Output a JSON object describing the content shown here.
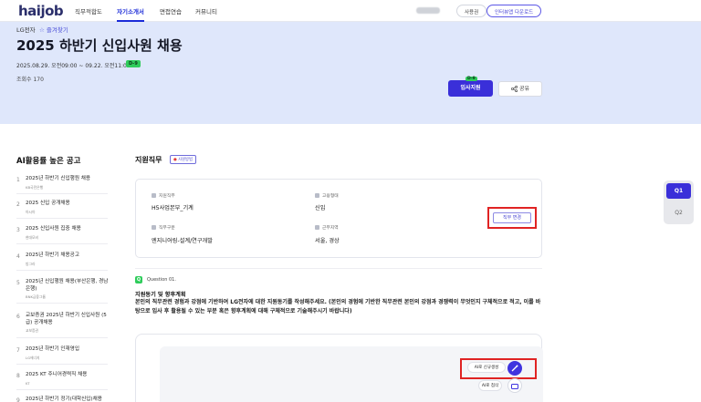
{
  "header": {
    "logo": "haijob",
    "tabs": [
      {
        "label": "직무적합도",
        "active": false
      },
      {
        "label": "자기소개서",
        "active": true
      },
      {
        "label": "면접연습",
        "active": false
      },
      {
        "label": "커뮤니티",
        "active": false
      }
    ],
    "user_label": "사용권",
    "download_button": "인터뷰앱 다운로드"
  },
  "job": {
    "company": "LG전자",
    "favorite": "즐겨찾기",
    "title": "2025 하반기 신입사원 채용",
    "period": "2025.08.29. 오전09:00 ~ 09.22. 오전11:00",
    "dday": "D-9",
    "views": "조회수 170",
    "apply_button": "입사지원",
    "apply_dday": "D-9",
    "share_button": "공유"
  },
  "sidebar": {
    "title": "AI활용률 높은 공고",
    "items": [
      {
        "num": "1",
        "title": "2025년 하반기 신입행원 채용",
        "company": "KB국민은행"
      },
      {
        "num": "2",
        "title": "2025 신입 공개채용",
        "company": "아시아"
      },
      {
        "num": "3",
        "title": "2025 신입사원 집중 채용",
        "company": "현대모비"
      },
      {
        "num": "4",
        "title": "2025년 하반기 채용공고",
        "company": "방그라"
      },
      {
        "num": "5",
        "title": "2025년 신입행원 채용(부산은행, 경남은행)",
        "company": "BNK금융그룹"
      },
      {
        "num": "6",
        "title": "교보증권 2025년 하반기 신입사원 (5급) 공개채용",
        "company": "교보증권"
      },
      {
        "num": "7",
        "title": "2025년 하반기 인재영입",
        "company": "LG에너지"
      },
      {
        "num": "8",
        "title": "2025 KT 주니어경력직 채용",
        "company": "KT"
      },
      {
        "num": "9",
        "title": "2025년 하반기 정기(대학신입)채용",
        "company": ""
      }
    ]
  },
  "position": {
    "section_title": "지원직무",
    "badge": "사원방법",
    "labels": {
      "job": "지원직무",
      "type": "고용형태",
      "category": "직무구분",
      "location": "근무지역"
    },
    "values": {
      "job": "H5사업본부_기계",
      "type": "신입",
      "category": "엔지니어링-설계/연구개발",
      "location": "서울, 경상"
    },
    "change_button": "직무 변경"
  },
  "question": {
    "icon": "Q",
    "label": "Question 01.",
    "heading": "지원동기 및 향후계획",
    "text": "본인의 직무관련 경험과 강점에 기반하여 LG전자에 대한 지원동기를 작성해주세요. (본인의 경험에 기반한 직무관련 본인의 강점과 경쟁력이 무엇인지 구체적으로 적고, 이를 바탕으로 입사 후 활용될 수 있는 부분 혹은 향후계획에 대해 구체적으로 기술해주시기 바랍니다)"
  },
  "ai_tools": {
    "generate": "AI로 신규생성",
    "edit": "AI로 첨삭"
  },
  "question_nav": [
    {
      "label": "Q1",
      "active": true
    },
    {
      "label": "Q2",
      "active": false
    }
  ]
}
